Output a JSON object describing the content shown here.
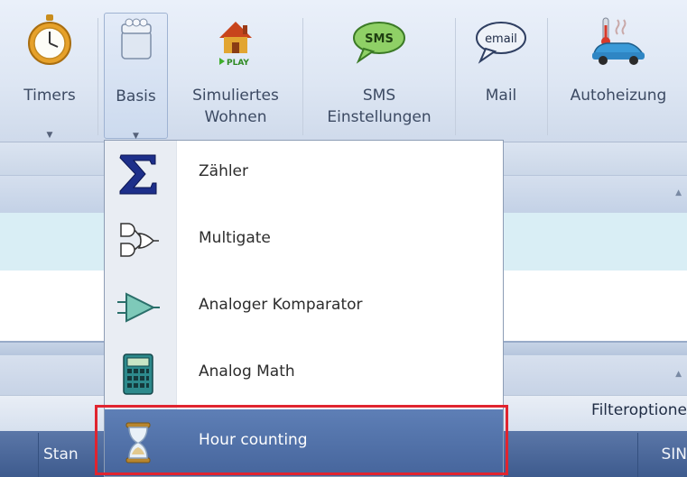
{
  "ribbon": {
    "buttons": [
      {
        "label": "Timers",
        "icon": "stopwatch-icon",
        "has_dropdown": true
      },
      {
        "label": "Basis",
        "icon": "blocks-icon",
        "has_dropdown": true,
        "active": true
      },
      {
        "label": "Simuliertes Wohnen",
        "line1": "Simuliertes",
        "line2": "Wohnen",
        "icon": "house-play-icon",
        "badge": "PLAY"
      },
      {
        "label": "SMS Einstellungen",
        "line1": "SMS",
        "line2": "Einstellungen",
        "icon": "sms-bubble-icon",
        "badge": "SMS"
      },
      {
        "label": "Mail",
        "icon": "email-bubble-icon",
        "badge": "email"
      },
      {
        "label": "Autoheizung",
        "icon": "car-heater-icon"
      }
    ]
  },
  "menu": {
    "items": [
      {
        "label": "Zähler",
        "icon": "sigma-icon"
      },
      {
        "label": "Multigate",
        "icon": "logic-gates-icon"
      },
      {
        "label": "Analoger Komparator",
        "icon": "comparator-icon"
      },
      {
        "label": "Analog Math",
        "icon": "calculator-icon"
      },
      {
        "label": "Hour counting",
        "icon": "hourglass-icon",
        "highlighted": true
      }
    ]
  },
  "background": {
    "filter_text": "Filteroptione",
    "column_left": "Stan",
    "column_right": "SIN"
  },
  "colors": {
    "highlight": "#4f6fa6",
    "selection_outline": "#e0242f",
    "ribbon_bg": "#dde6f3"
  }
}
